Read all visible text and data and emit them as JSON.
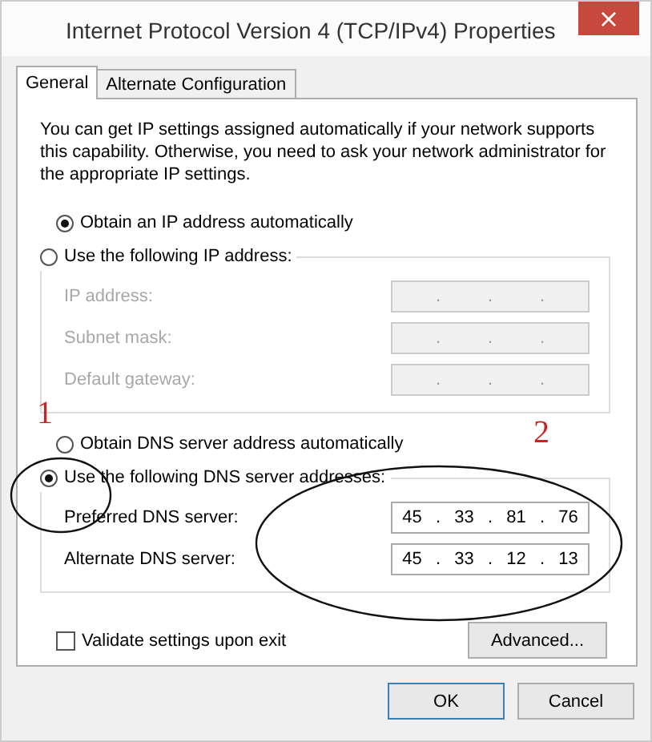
{
  "window": {
    "title": "Internet Protocol Version 4 (TCP/IPv4) Properties",
    "close": "×"
  },
  "tabs": [
    {
      "label": "General",
      "selected": true
    },
    {
      "label": "Alternate Configuration",
      "selected": false
    }
  ],
  "intro": "You can get IP settings assigned automatically if your network supports this capability. Otherwise, you need to ask your network administrator for the appropriate IP settings.",
  "ip_mode": [
    {
      "label": "Obtain an IP address automatically",
      "selected": true
    },
    {
      "label": "Use the following IP address:",
      "selected": false
    }
  ],
  "ip_fields": [
    {
      "label": "IP address:",
      "disabled": true,
      "dots": [
        ".",
        ".",
        "."
      ]
    },
    {
      "label": "Subnet mask:",
      "disabled": true,
      "dots": [
        ".",
        ".",
        "."
      ]
    },
    {
      "label": "Default gateway:",
      "disabled": true,
      "dots": [
        ".",
        ".",
        "."
      ]
    }
  ],
  "dns_mode": [
    {
      "label": "Obtain DNS server address automatically",
      "selected": false
    },
    {
      "label": "Use the following DNS server addresses:",
      "selected": true
    }
  ],
  "dns_fields": [
    {
      "label": "Preferred DNS server:",
      "disabled": false,
      "octets": [
        "45",
        "33",
        "81",
        "76"
      ],
      "dots": [
        ".",
        ".",
        "."
      ]
    },
    {
      "label": "Alternate DNS server:",
      "disabled": false,
      "octets": [
        "45",
        "33",
        "12",
        "13"
      ],
      "dots": [
        ".",
        ".",
        "."
      ]
    }
  ],
  "validate": {
    "label": "Validate settings upon exit",
    "checked": false
  },
  "advanced_button": "Advanced...",
  "buttons": [
    {
      "label": "OK",
      "kind": "default"
    },
    {
      "label": "Cancel",
      "kind": "normal"
    }
  ],
  "annotations": [
    {
      "text": "1",
      "color": "#cc2222"
    },
    {
      "text": "2",
      "color": "#cc2222"
    }
  ]
}
